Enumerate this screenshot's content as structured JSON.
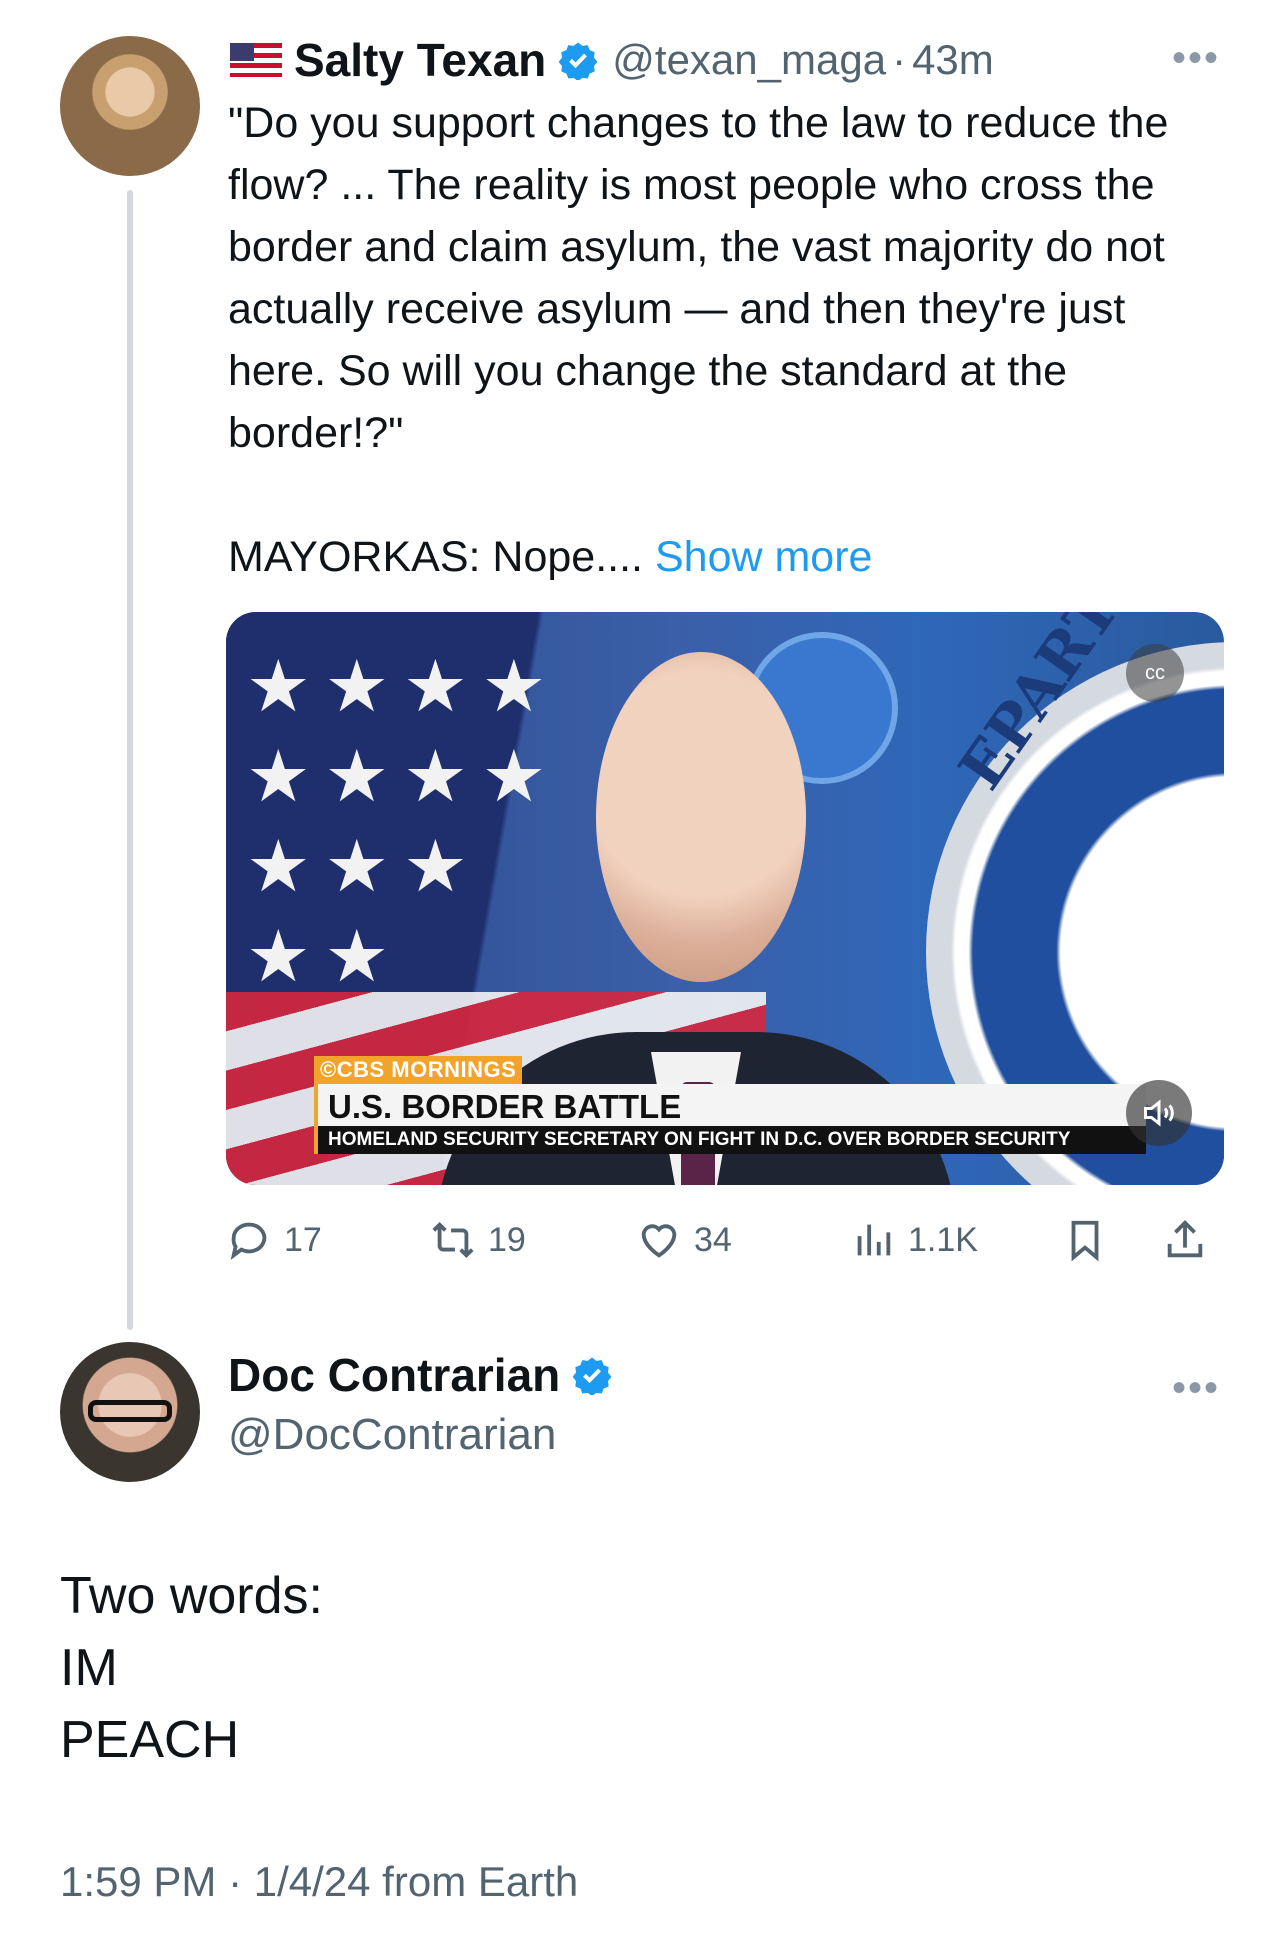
{
  "tweet1": {
    "flag_icon": "us-flag-emoji",
    "author_name": "Salty Texan",
    "handle": "@texan_maga",
    "separator": "·",
    "time_ago": "43m",
    "more_icon": "more-horizontal-icon",
    "text": "\"Do you support changes to the law to reduce the flow? ... The reality is most people who cross the border and claim asylum, the vast majority do not actually receive asylum — and then they're just here. So will you change the standard at the border!?\"\n\nMAYORKAS: Nope.... ",
    "show_more": "Show more",
    "media": {
      "network_tag": "©CBS MORNINGS",
      "headline": "U.S. BORDER BATTLE",
      "subheadline": "HOMELAND SECURITY SECRETARY ON FIGHT IN D.C. OVER BORDER SECURITY",
      "seal_text": "EPARTMEN",
      "cc_label": "cc"
    },
    "actions": {
      "replies": "17",
      "retweets": "19",
      "likes": "34",
      "views": "1.1K"
    }
  },
  "tweet2": {
    "author_name": "Doc Contrarian",
    "handle": "@DocContrarian",
    "more_icon": "more-horizontal-icon",
    "lines": [
      "Two words:",
      "IM",
      "PEACH"
    ],
    "timestamp": "1:59 PM · 1/4/24 from Earth"
  },
  "colors": {
    "link": "#1d9bf0",
    "secondary_text": "#536471",
    "primary_text": "#0f1419",
    "thread_line": "#cfd9de"
  }
}
